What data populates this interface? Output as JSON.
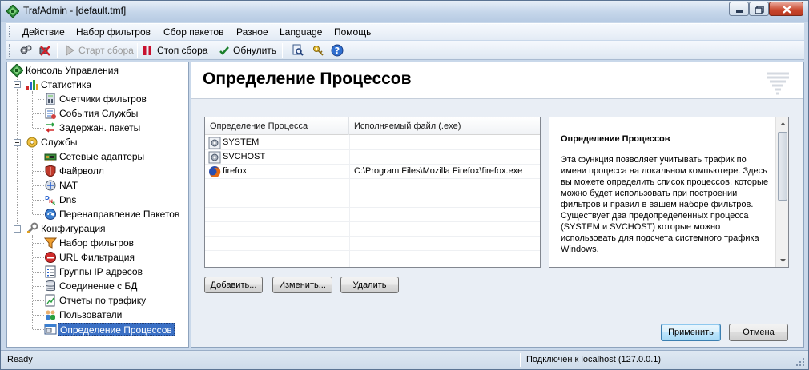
{
  "window": {
    "title": "TrafAdmin - [default.tmf]"
  },
  "menu": {
    "items": [
      "Действие",
      "Набор фильтров",
      "Сбор пакетов",
      "Разное",
      "Language",
      "Помощь"
    ]
  },
  "toolbar": {
    "start_label": "Старт сбора",
    "stop_label": "Стоп сбора",
    "reset_label": "Обнулить"
  },
  "tree": {
    "root": "Консоль Управления",
    "statistics": {
      "label": "Статистика",
      "children": [
        "Счетчики фильтров",
        "События Службы",
        "Задержан. пакеты"
      ]
    },
    "services": {
      "label": "Службы",
      "children": [
        "Сетевые адаптеры",
        "Файрволл",
        "NAT",
        "Dns",
        "Перенаправление Пакетов"
      ]
    },
    "config": {
      "label": "Конфигурация",
      "children": [
        "Набор фильтров",
        "URL Фильтрация",
        "Группы IP адресов",
        "Соединение с БД",
        "Отчеты по трафику",
        "Пользователи",
        "Определение Процессов"
      ]
    }
  },
  "page": {
    "title": "Определение Процессов"
  },
  "process_list": {
    "columns": [
      "Определение Процесса",
      "Исполняемый файл (.exe)"
    ],
    "rows": [
      {
        "name": "SYSTEM",
        "exe": "",
        "icon": "system-process-icon"
      },
      {
        "name": "SVCHOST",
        "exe": "",
        "icon": "system-process-icon"
      },
      {
        "name": "firefox",
        "exe": "C:\\Program Files\\Mozilla Firefox\\firefox.exe",
        "icon": "firefox-icon"
      }
    ]
  },
  "description": {
    "title": "Определение Процессов",
    "body": "Эта функция позволяет учитывать трафик по имени процесса на локальном компьютере. Здесь вы можете определить список процессов, которые можно будет использовать при построении фильтров и правил в вашем наборе фильтров. Существует два предопределенных процесса (SYSTEM и SVCHOST) которые можно использовать для подсчета системного трафика Windows."
  },
  "buttons": {
    "add": "Добавить...",
    "edit": "Изменить...",
    "delete": "Удалить",
    "apply": "Применить",
    "cancel": "Отмена"
  },
  "status": {
    "left": "Ready",
    "right": "Подключен к localhost (127.0.0.1)"
  }
}
